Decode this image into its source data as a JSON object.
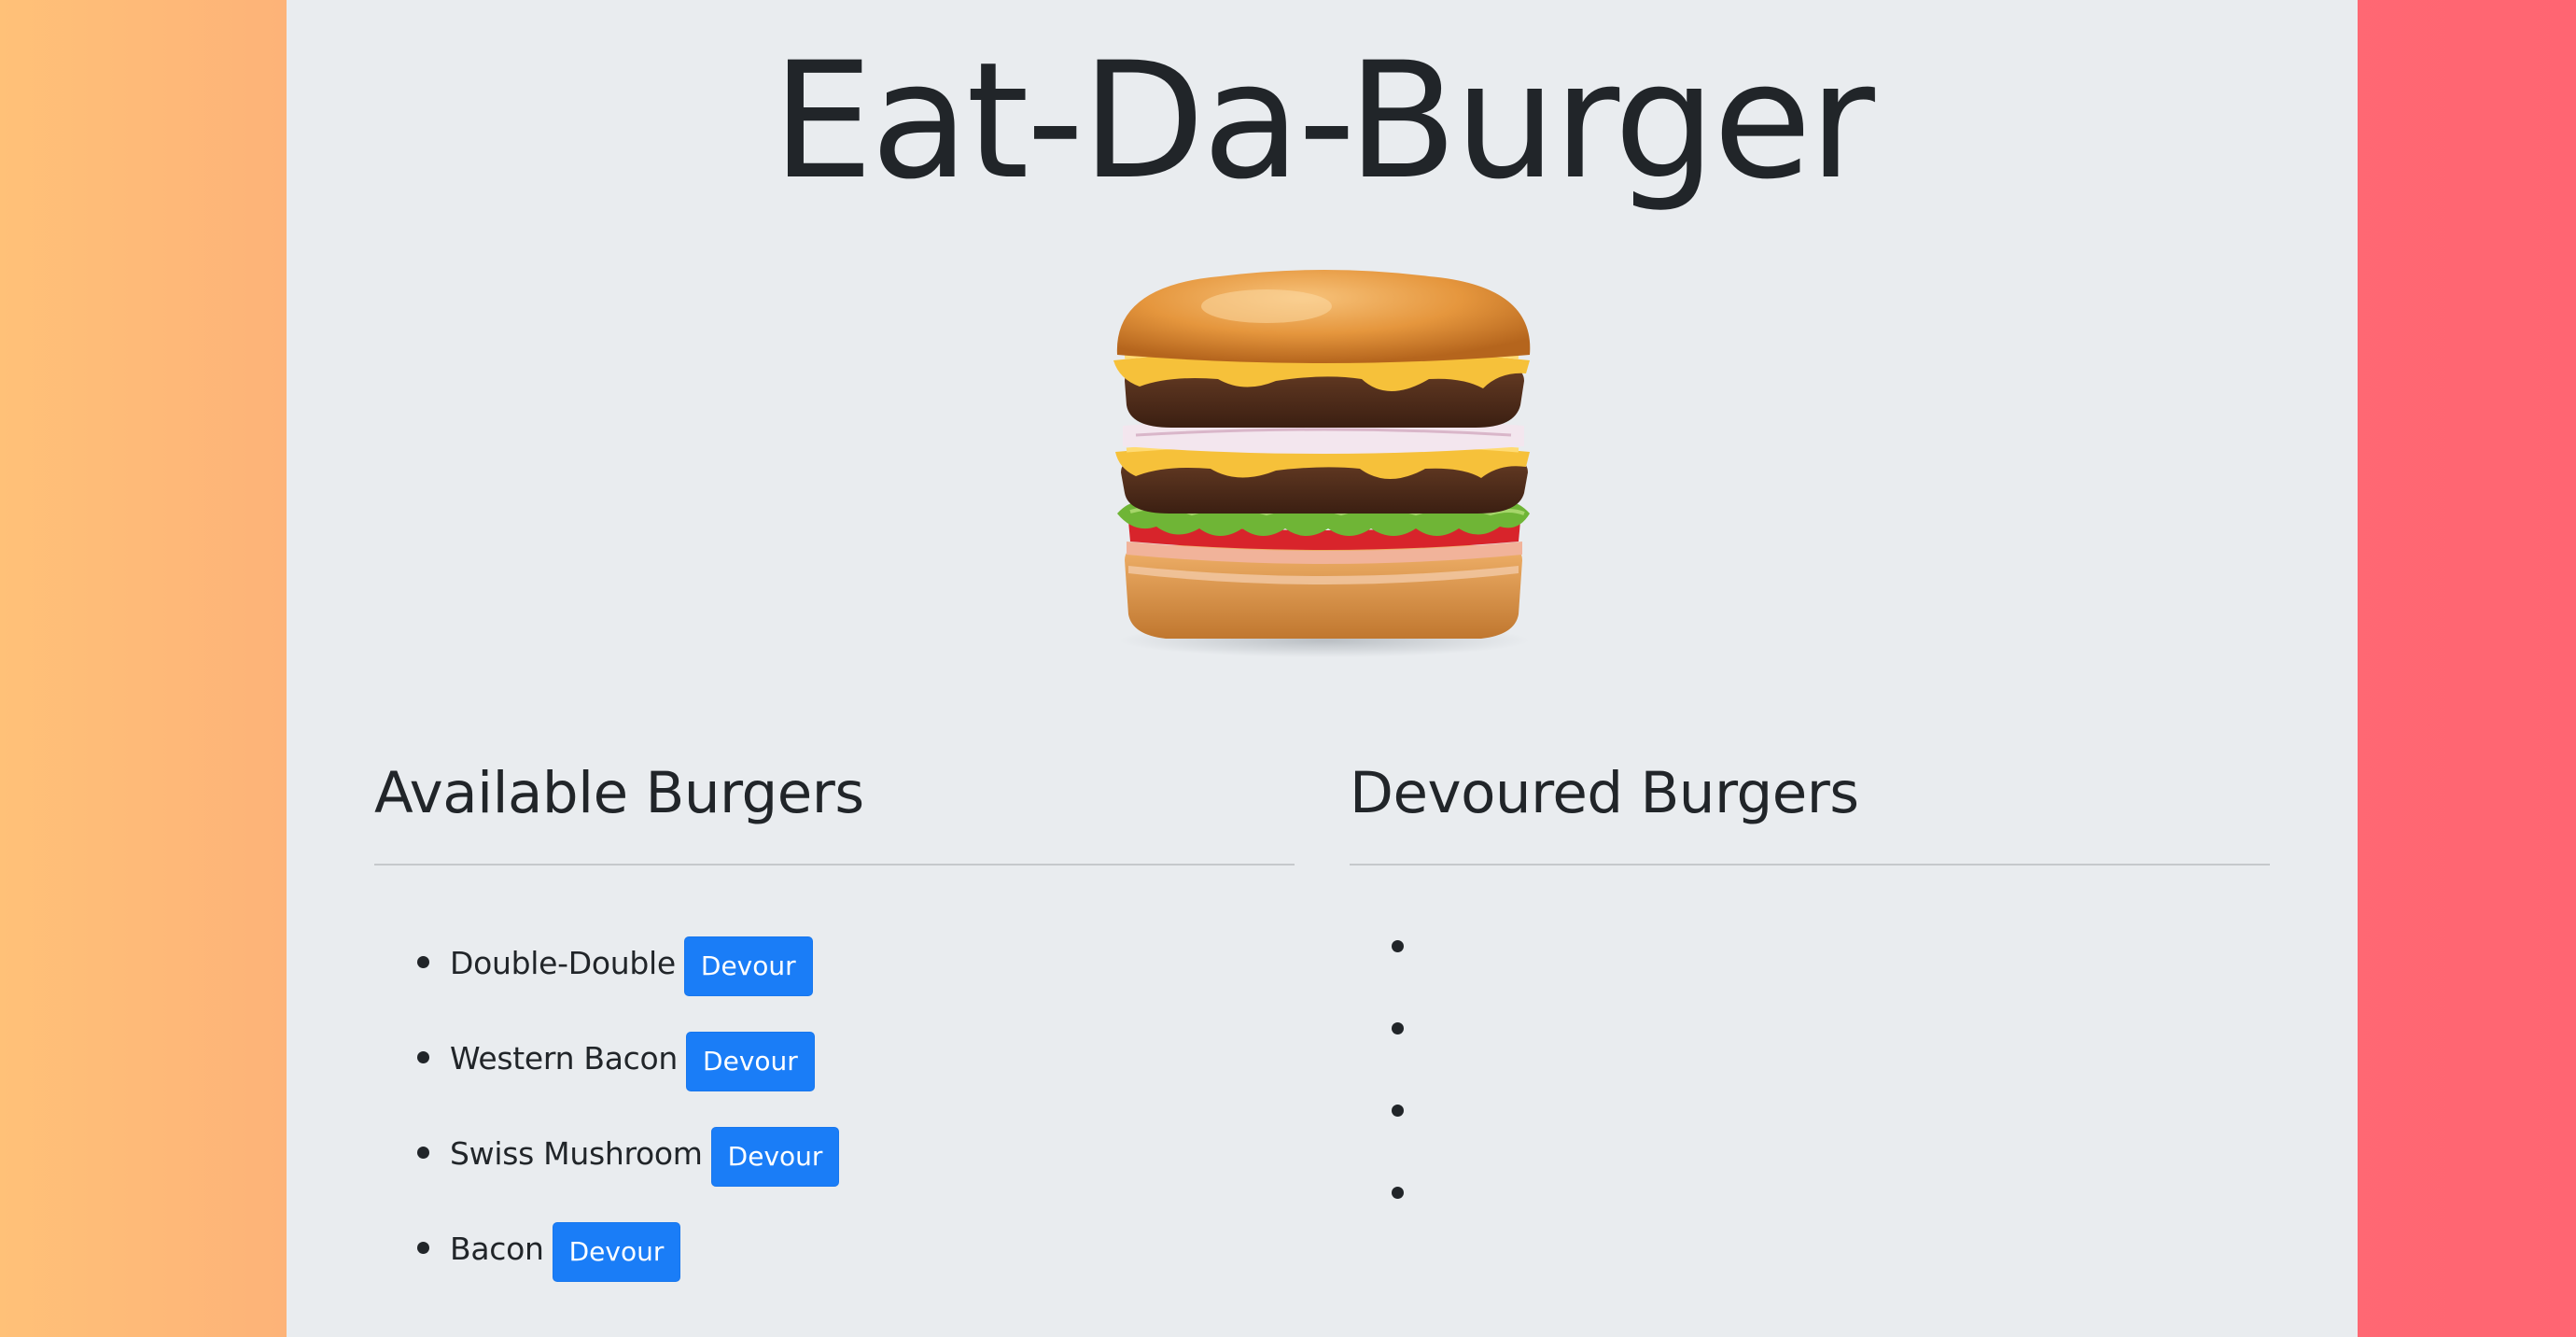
{
  "header": {
    "title": "Eat-Da-Burger"
  },
  "hero_image": {
    "icon": "burger-image"
  },
  "available": {
    "heading": "Available Burgers",
    "button_label": "Devour",
    "items": [
      {
        "name": "Double-Double",
        "button": "Devour"
      },
      {
        "name": "Western Bacon",
        "button": "Devour"
      },
      {
        "name": "Swiss Mushroom",
        "button": "Devour"
      },
      {
        "name": "Bacon",
        "button": "Devour"
      }
    ]
  },
  "devoured": {
    "heading": "Devoured Burgers",
    "items": [
      {
        "name": ""
      },
      {
        "name": ""
      },
      {
        "name": ""
      },
      {
        "name": ""
      }
    ]
  },
  "colors": {
    "accent": "#1a7df7",
    "panel": "#e9ecef",
    "gradient_left": "#ffc178",
    "gradient_right": "#ff6572"
  }
}
